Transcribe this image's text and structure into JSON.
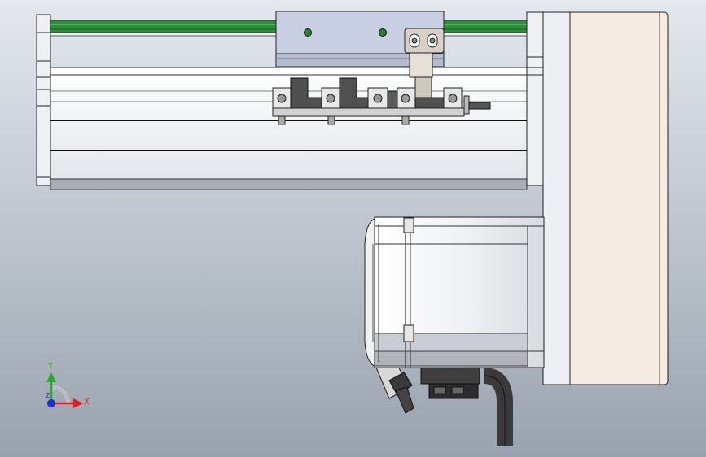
{
  "viewport": {
    "background_top": "#e4e8ee",
    "background_bottom": "#98a2ae"
  },
  "triad": {
    "x_label": "X",
    "y_label": "Y",
    "z_label": "Z",
    "x_color": "#e02020",
    "y_color": "#22b022",
    "z_color": "#2030d0"
  },
  "colors": {
    "rail_green": "#2e8f3a",
    "motor_housing": "#f6ebe2",
    "carriage": "#c9cfe2",
    "sensor_dark": "#505050",
    "cable": "#3a3a3a"
  }
}
